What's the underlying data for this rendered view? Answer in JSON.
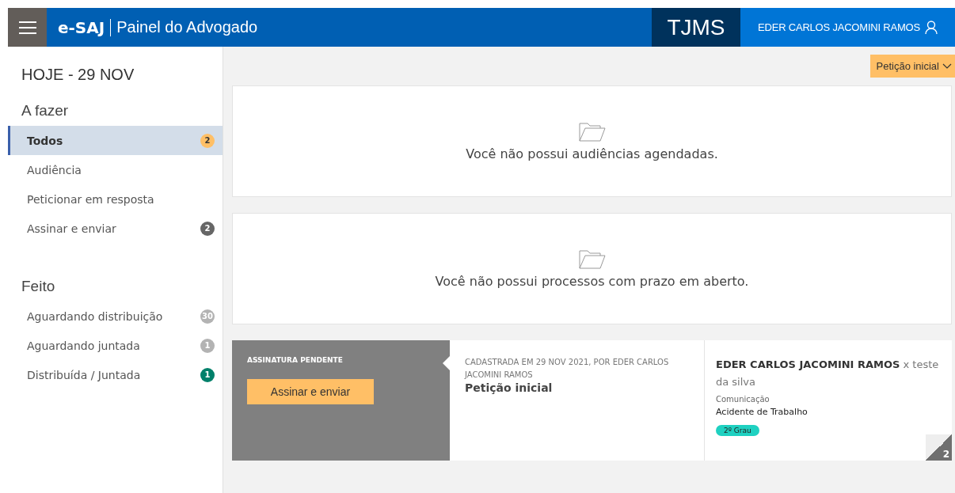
{
  "header": {
    "brand": "e-SAJ",
    "subtitle": "Painel do Advogado",
    "court": "TJMS",
    "user": "EDER CARLOS JACOMINI RAMOS"
  },
  "sidebar": {
    "date": "HOJE - 29 NOV",
    "sections": [
      {
        "title": "A fazer",
        "items": [
          {
            "label": "Todos",
            "selected": true,
            "badge": "2",
            "color": "#ffbf66"
          },
          {
            "label": "Audiência",
            "selected": false
          },
          {
            "label": "Peticionar em resposta",
            "selected": false
          },
          {
            "label": "Assinar e enviar",
            "selected": false,
            "badge": "2",
            "color": "#666666"
          }
        ]
      },
      {
        "title": "Feito",
        "items": [
          {
            "label": "Aguardando distribuição",
            "selected": false,
            "badge": "30",
            "color": "#b3b3b3"
          },
          {
            "label": "Aguardando juntada",
            "selected": false,
            "badge": "1",
            "color": "#b3b3b3"
          },
          {
            "label": "Distribuída / Juntada",
            "selected": false,
            "badge": "1",
            "color": "#00806a"
          }
        ]
      }
    ]
  },
  "filter": {
    "label": "Petição inicial"
  },
  "empty_panels": [
    "Você não possui audiências agendadas.",
    "Você não possui processos com prazo em aberto."
  ],
  "card": {
    "status": "ASSINATURA PENDENTE",
    "action": "Assinar e enviar",
    "registered": "CADASTRADA EM 29 NOV 2021, POR EDER CARLOS JACOMINI RAMOS",
    "title": "Petição inicial",
    "parties": "**EDER CARLOS JACOMINI RAMOS** x teste da silva",
    "class_label": "Comunicação",
    "class_value": "Acidente de Trabalho",
    "tag": "2º Grau",
    "corner": "2"
  }
}
